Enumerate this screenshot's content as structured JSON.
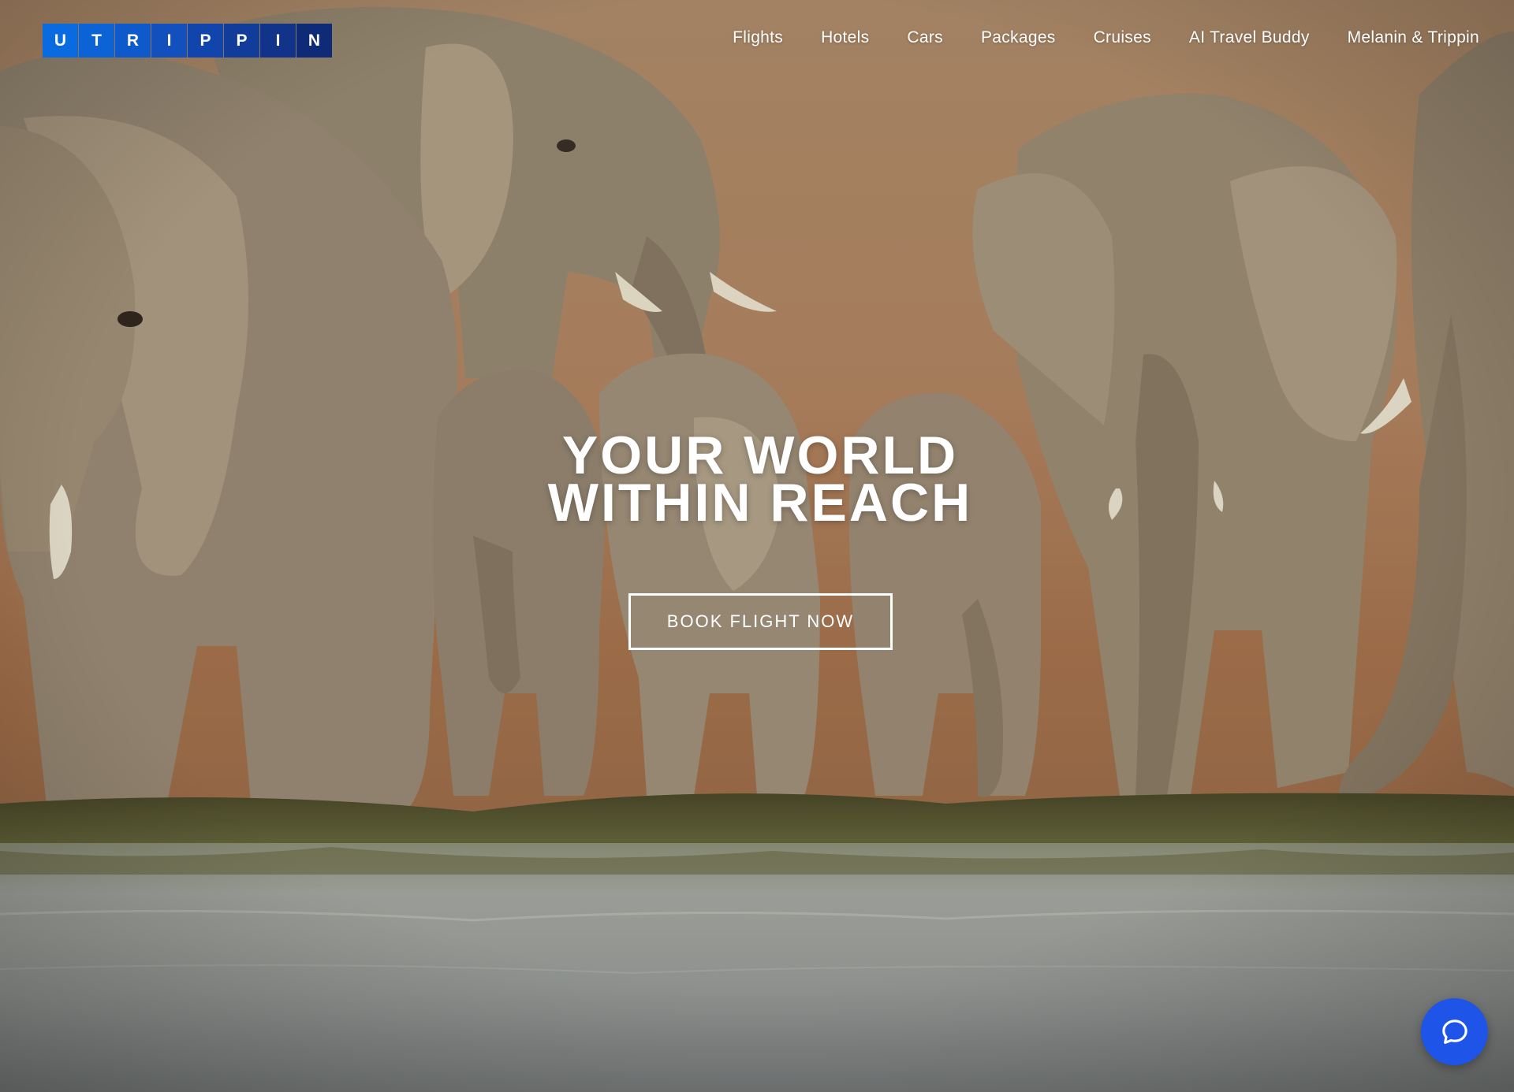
{
  "logo": {
    "letters": [
      "U",
      "T",
      "R",
      "I",
      "P",
      "P",
      "I",
      "N"
    ],
    "tile_colors": [
      "#0a6be0",
      "#0c63d6",
      "#0f5acb",
      "#1150bd",
      "#1245ab",
      "#123c9a",
      "#113389",
      "#0f2b78"
    ]
  },
  "nav": {
    "items": [
      {
        "label": "Flights"
      },
      {
        "label": "Hotels"
      },
      {
        "label": "Cars"
      },
      {
        "label": "Packages"
      },
      {
        "label": "Cruises"
      },
      {
        "label": "AI Travel Buddy"
      },
      {
        "label": "Melanin & Trippin"
      }
    ]
  },
  "hero": {
    "title_line1": "YOUR WORLD",
    "title_line2": "WITHIN REACH",
    "cta_label": "BOOK FLIGHT NOW",
    "background": "elephant-herd-at-waterhole-photo"
  },
  "chat": {
    "icon": "chat-bubble-icon",
    "color": "#1e55e8"
  }
}
